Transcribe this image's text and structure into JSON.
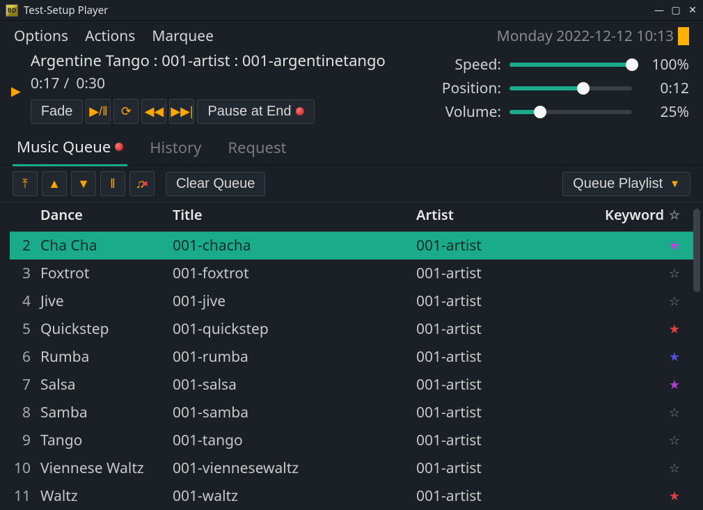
{
  "window": {
    "title": "Test-Setup Player",
    "app_icon_text": "BD"
  },
  "menu": {
    "options": "Options",
    "actions": "Actions",
    "marquee": "Marquee"
  },
  "datetime": "Monday 2022-12-12 10:13",
  "nowplaying": {
    "label": "Argentine Tango : 001-artist : 001-argentinetango",
    "elapsed": "0:17",
    "sep": "/",
    "total": "0:30"
  },
  "controls": {
    "fade": "Fade",
    "pause_at_end": "Pause at End"
  },
  "sliders": {
    "speed": {
      "label": "Speed:",
      "value": "100%",
      "pct": 100
    },
    "position": {
      "label": "Position:",
      "value": "0:12",
      "pct": 60
    },
    "volume": {
      "label": "Volume:",
      "value": "25%",
      "pct": 25
    }
  },
  "tabs": {
    "musicqueue": "Music Queue",
    "history": "History",
    "request": "Request"
  },
  "queuebar": {
    "clear": "Clear Queue",
    "playlist_btn": "Queue Playlist"
  },
  "columns": {
    "dance": "Dance",
    "title": "Title",
    "artist": "Artist",
    "keyword": "Keyword"
  },
  "rows": [
    {
      "n": "2",
      "dance": "Cha Cha",
      "title": "001-chacha",
      "artist": "001-artist",
      "star": "magenta",
      "sel": true
    },
    {
      "n": "3",
      "dance": "Foxtrot",
      "title": "001-foxtrot",
      "artist": "001-artist",
      "star": "outline"
    },
    {
      "n": "4",
      "dance": "Jive",
      "title": "001-jive",
      "artist": "001-artist",
      "star": "outline"
    },
    {
      "n": "5",
      "dance": "Quickstep",
      "title": "001-quickstep",
      "artist": "001-artist",
      "star": "red"
    },
    {
      "n": "6",
      "dance": "Rumba",
      "title": "001-rumba",
      "artist": "001-artist",
      "star": "blue"
    },
    {
      "n": "7",
      "dance": "Salsa",
      "title": "001-salsa",
      "artist": "001-artist",
      "star": "purple"
    },
    {
      "n": "8",
      "dance": "Samba",
      "title": "001-samba",
      "artist": "001-artist",
      "star": "outline"
    },
    {
      "n": "9",
      "dance": "Tango",
      "title": "001-tango",
      "artist": "001-artist",
      "star": "outline"
    },
    {
      "n": "10",
      "dance": "Viennese Waltz",
      "title": "001-viennesewaltz",
      "artist": "001-artist",
      "star": "outline"
    },
    {
      "n": "11",
      "dance": "Waltz",
      "title": "001-waltz",
      "artist": "001-artist",
      "star": "red"
    }
  ]
}
